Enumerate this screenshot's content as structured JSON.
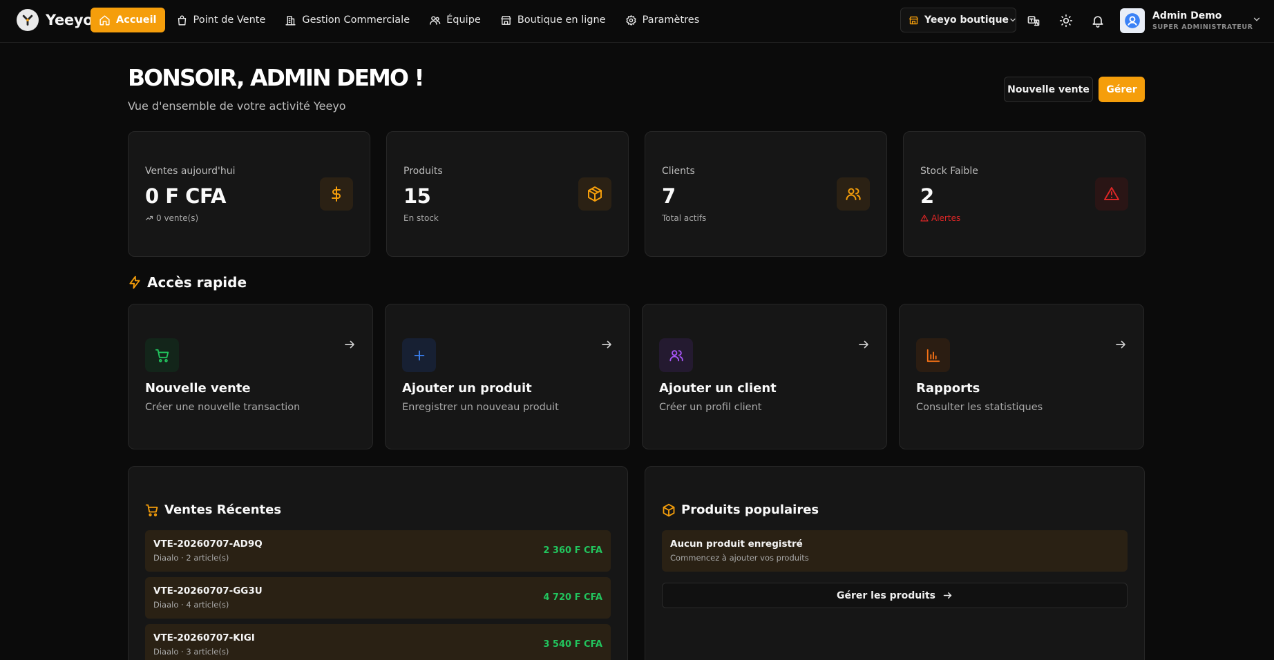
{
  "app": {
    "name": "Yeeyo"
  },
  "nav": {
    "items": [
      {
        "label": "Accueil",
        "icon": "home-icon",
        "active": true
      },
      {
        "label": "Point de Vente",
        "icon": "shopping-bag-icon"
      },
      {
        "label": "Gestion Commerciale",
        "icon": "building-icon"
      },
      {
        "label": "Équipe",
        "icon": "users-icon"
      },
      {
        "label": "Boutique en ligne",
        "icon": "store-icon"
      },
      {
        "label": "Paramètres",
        "icon": "gear-icon"
      }
    ]
  },
  "topbar": {
    "store_select": "Yeeyo boutique",
    "user_name": "Admin Demo",
    "user_role": "SUPER ADMINISTRATEUR"
  },
  "header": {
    "greeting": "BONSOIR, ADMIN DEMO !",
    "subtitle": "Vue d'ensemble de votre activité Yeeyo",
    "new_sale_button": "Nouvelle vente",
    "manage_button": "Gérer"
  },
  "stats": [
    {
      "label": "Ventes aujourd'hui",
      "value": "0 F CFA",
      "sub": "0 vente(s)",
      "icon": "dollar-icon",
      "color": "#f59e0b"
    },
    {
      "label": "Produits",
      "value": "15",
      "sub": "En stock",
      "icon": "box-icon",
      "color": "#f59e0b"
    },
    {
      "label": "Clients",
      "value": "7",
      "sub": "Total actifs",
      "icon": "users-icon",
      "color": "#f59e0b"
    },
    {
      "label": "Stock Faible",
      "value": "2",
      "sub": "Alertes",
      "icon": "warning-icon",
      "color": "#dc2626"
    }
  ],
  "quick_access": {
    "title": "Accès rapide",
    "items": [
      {
        "title": "Nouvelle vente",
        "desc": "Créer une nouvelle transaction",
        "icon": "cart-icon",
        "color": "#22c55e"
      },
      {
        "title": "Ajouter un produit",
        "desc": "Enregistrer un nouveau produit",
        "icon": "plus-icon",
        "color": "#3b82f6"
      },
      {
        "title": "Ajouter un client",
        "desc": "Créer un profil client",
        "icon": "users-icon",
        "color": "#a855f7"
      },
      {
        "title": "Rapports",
        "desc": "Consulter les statistiques",
        "icon": "bar-chart-icon",
        "color": "#f97316"
      }
    ]
  },
  "recent_sales": {
    "title": "Ventes Récentes",
    "rows": [
      {
        "id": "VTE-20260707-AD9Q",
        "meta": "Diaalo · 2 article(s)",
        "amount": "2 360 F CFA"
      },
      {
        "id": "VTE-20260707-GG3U",
        "meta": "Diaalo · 4 article(s)",
        "amount": "4 720 F CFA"
      },
      {
        "id": "VTE-20260707-KIGI",
        "meta": "Diaalo · 3 article(s)",
        "amount": "3 540 F CFA"
      }
    ]
  },
  "popular_products": {
    "title": "Produits populaires",
    "empty_title": "Aucun produit enregistré",
    "empty_sub": "Commencez à ajouter vos produits",
    "manage_button": "Gérer les produits"
  }
}
